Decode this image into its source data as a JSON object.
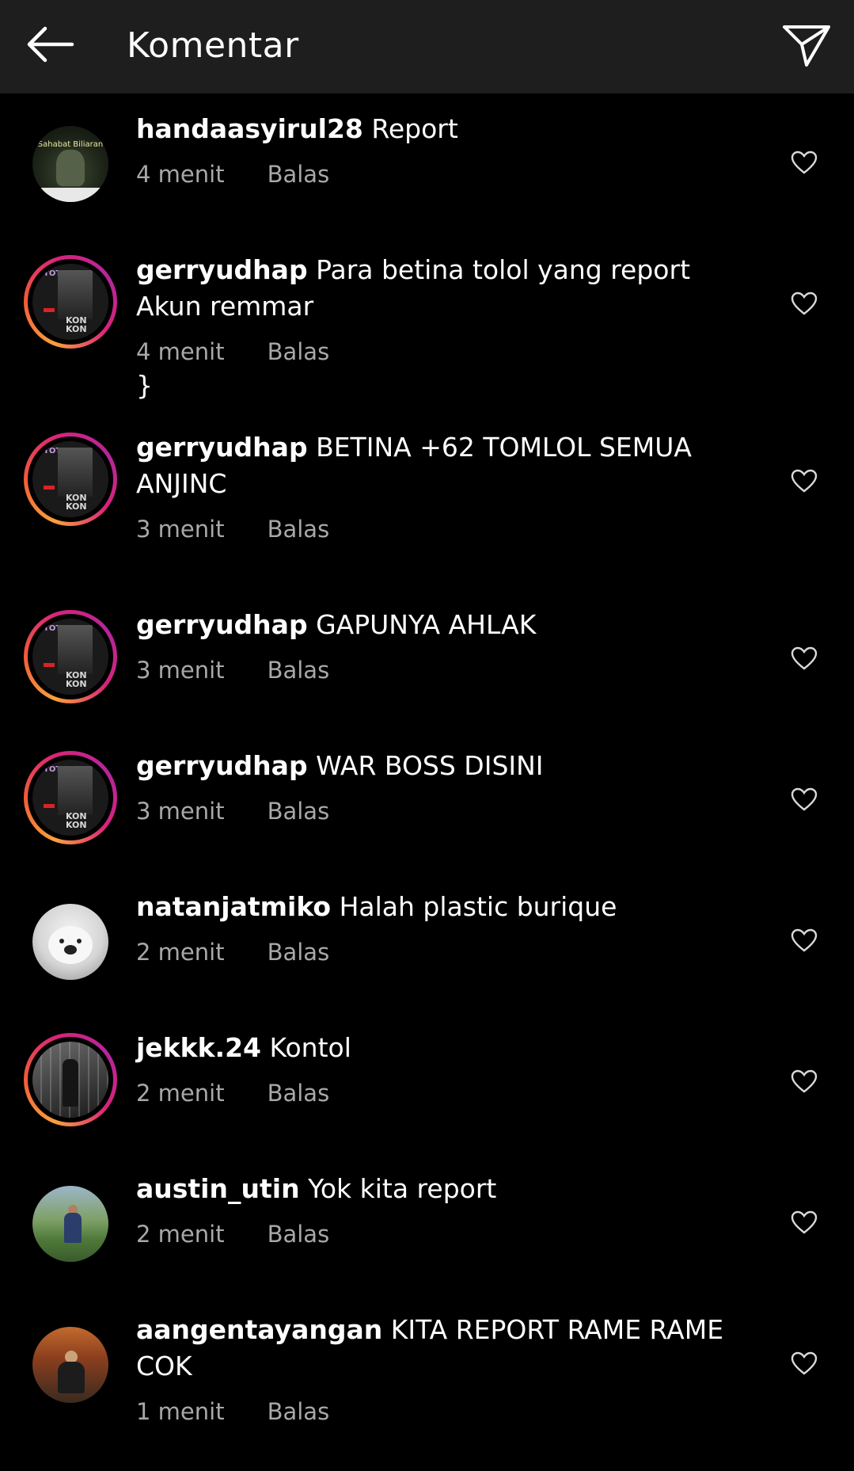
{
  "header": {
    "title": "Komentar"
  },
  "comments": [
    {
      "username": "handaasyirul28",
      "text": "Report",
      "time": "4 menit",
      "reply": "Balas",
      "avatar_text": "Sahabat Biliaran"
    },
    {
      "username": "gerryudhap",
      "text": "Para betina tolol yang report Akun remmar",
      "time": "4 menit",
      "reply": "Balas",
      "avatar_top": "TOT",
      "avatar_bottom": "KON KON"
    },
    {
      "username": "gerryudhap",
      "text": "BETINA +62 TOMLOL SEMUA ANJINC",
      "time": "3 menit",
      "reply": "Balas",
      "avatar_top": "TOT",
      "avatar_bottom": "KON KON"
    },
    {
      "username": "gerryudhap",
      "text": "GAPUNYA AHLAK",
      "time": "3 menit",
      "reply": "Balas",
      "avatar_top": "TOT",
      "avatar_bottom": "KON KON"
    },
    {
      "username": "gerryudhap",
      "text": "WAR BOSS DISINI",
      "time": "3 menit",
      "reply": "Balas",
      "avatar_top": "TOT",
      "avatar_bottom": "KON KON"
    },
    {
      "username": "natanjatmiko",
      "text": "Halah plastic burique",
      "time": "2 menit",
      "reply": "Balas"
    },
    {
      "username": "jekkk.24",
      "text": "Kontol",
      "time": "2 menit",
      "reply": "Balas"
    },
    {
      "username": "austin_utin",
      "text": "Yok kita report",
      "time": "2 menit",
      "reply": "Balas"
    },
    {
      "username": "aangentayangan",
      "text": "KITA REPORT RAME RAME COK",
      "time": "1 menit",
      "reply": "Balas"
    }
  ]
}
